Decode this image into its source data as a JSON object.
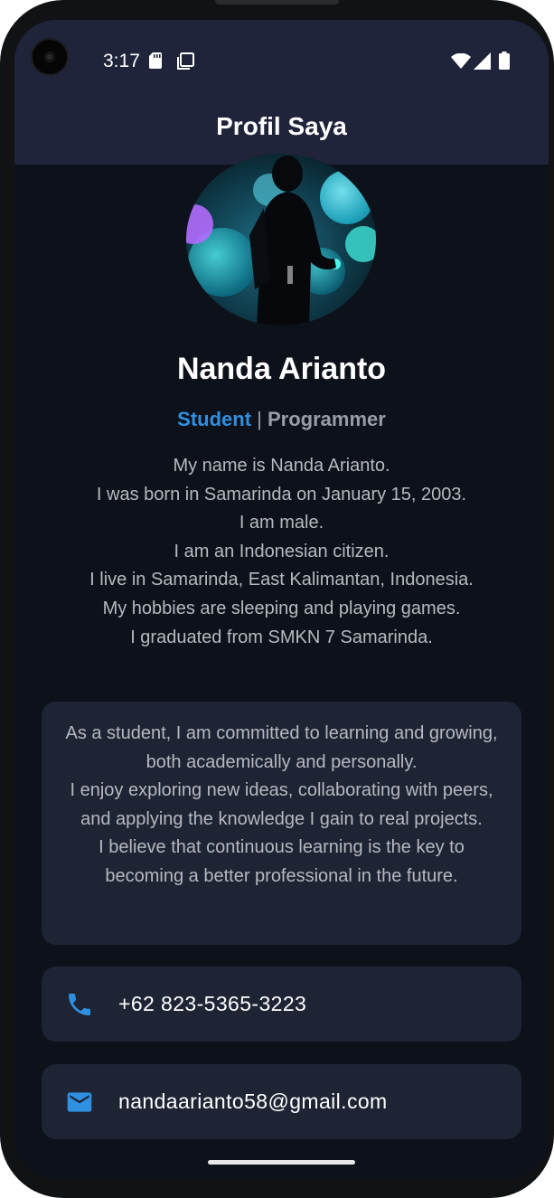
{
  "status_bar": {
    "time": "3:17",
    "icons": [
      "sd-card-icon",
      "screen-icon",
      "wifi-icon",
      "signal-icon",
      "battery-icon"
    ]
  },
  "app_bar": {
    "title": "Profil Saya"
  },
  "profile": {
    "name": "Nanda Arianto",
    "role_primary": "Student",
    "role_separator": "|",
    "role_secondary": "Programmer",
    "bio_lines": [
      "My name is Nanda Arianto.",
      "I was born in Samarinda on January 15, 2003.",
      "I am male.",
      "I am an Indonesian citizen.",
      "I live in Samarinda, East Kalimantan, Indonesia.",
      "My hobbies are sleeping and playing games.",
      "I graduated from SMKN 7 Samarinda."
    ]
  },
  "about": {
    "lines": [
      "As a student, I am committed to learning and growing, both academically and personally.",
      "I enjoy exploring new ideas, collaborating with peers, and applying the knowledge I gain to real projects.",
      "I believe that continuous learning is the key to becoming a better professional in the future."
    ]
  },
  "contacts": {
    "phone": "+62 823-5365-3223",
    "email": "nandaarianto58@gmail.com"
  },
  "colors": {
    "accent": "#2f8fe0",
    "app_bar": "#20243a",
    "background": "#0d111a",
    "card": "#1e2434",
    "muted_text": "#b7b9c0"
  }
}
